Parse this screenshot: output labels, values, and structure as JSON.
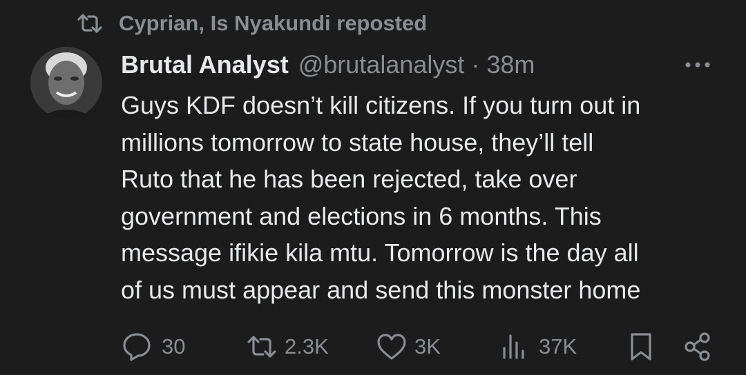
{
  "repost": {
    "label": "Cyprian, Is Nyakundi reposted",
    "icon": "repost-icon"
  },
  "tweet": {
    "display_name": "Brutal Analyst",
    "meta": "@brutalanalyst · 38m",
    "text": "Guys KDF doesn’t kill citizens. If you turn out in\nmillions tomorrow to state house, they’ll tell\nRuto that he has been rejected, take over\ngovernment and elections in 6 months. This\nmessage ifikie kila mtu. Tomorrow is the day all\nof us must appear and send this monster home"
  },
  "actions": {
    "replies": "30",
    "reposts": "2.3K",
    "likes": "3K",
    "views": "37K"
  },
  "colors": {
    "background": "#1c1c1c",
    "text": "#e7e9ea",
    "muted": "#8a8d91"
  }
}
